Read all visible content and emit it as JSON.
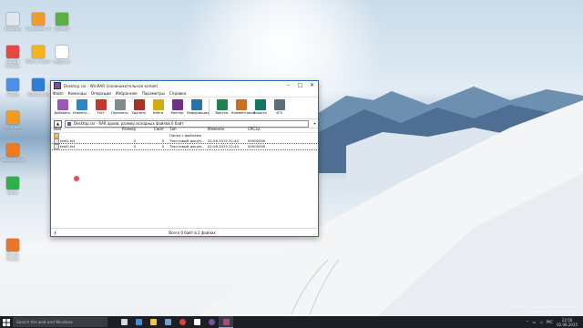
{
  "desktop": {
    "icons": [
      {
        "label": "Корзина",
        "color": "#dfe7ee"
      },
      {
        "label": "Безымянн. б",
        "color": "#f29a2e"
      },
      {
        "label": "uTorrent",
        "color": "#5fb043"
      },
      {
        "label": "Google Chrome",
        "color": "#e8473f"
      },
      {
        "label": "Mail.ru Агент",
        "color": "#f5b321"
      },
      {
        "label": "vegas.rar",
        "color": "#ffffff"
      },
      {
        "label": "Google",
        "color": "#4d8ee6"
      },
      {
        "label": "Проводник",
        "color": "#2e7dd6"
      },
      {
        "label": "mon exe",
        "color": "#f59a1e"
      },
      {
        "label": "Hearthstone",
        "color": "#f07a1a"
      },
      {
        "label": "Punto",
        "color": "#2fb14a"
      },
      {
        "label": "Mozilla Firefox",
        "color": "#e8762a"
      }
    ],
    "watermark_line1": "Windows 10 Enterprise Technical Preview",
    "watermark_line2": "Evaluation copy. Build 10240"
  },
  "window": {
    "title": "Desktop.rar - WinRAR (ознакомительная копия)",
    "controls": [
      "–",
      "□",
      "✕"
    ],
    "menu": [
      "Файл",
      "Команды",
      "Операции",
      "Избранное",
      "Параметры",
      "Справка"
    ],
    "toolbar": [
      {
        "label": "Добавить",
        "icon": "add-icon",
        "color": "#9b59b6"
      },
      {
        "label": "Извлечь...",
        "icon": "extract-icon",
        "color": "#2e86c1"
      },
      {
        "label": "Тест",
        "icon": "test-icon",
        "color": "#c0392b"
      },
      {
        "label": "Просмотр",
        "icon": "view-icon",
        "color": "#7f8c8d"
      },
      {
        "label": "Удалить",
        "icon": "delete-icon",
        "color": "#a93226"
      },
      {
        "label": "Найти",
        "icon": "find-icon",
        "color": "#d4ac0d"
      },
      {
        "label": "Мастер",
        "icon": "wizard-icon",
        "color": "#6c3483"
      },
      {
        "label": "Информация",
        "icon": "info-icon",
        "color": "#2874a6"
      },
      {
        "label": "Вирусы",
        "icon": "virus-icon",
        "color": "#1e8449"
      },
      {
        "label": "Комментарий",
        "icon": "comment-icon",
        "color": "#ca6f1e"
      },
      {
        "label": "Защита",
        "icon": "protect-icon",
        "color": "#117864"
      },
      {
        "label": "SFX",
        "icon": "sfx-icon",
        "color": "#5d6d7e"
      }
    ],
    "path": "Desktop.rar - RAR архив, размер исходных файлов 0 байт",
    "columns": [
      "Имя",
      "Размер",
      "Сжат",
      "Тип",
      "Изменён",
      "CRC32"
    ],
    "rows": [
      {
        "name": "..",
        "size": "",
        "packed": "",
        "type": "Папка с файлами",
        "modified": "",
        "crc": ""
      },
      {
        "name": "test1.txt",
        "size": "0",
        "packed": "0",
        "type": "Текстовый докум...",
        "modified": "02.06.2015 22:44",
        "crc": "00000000"
      },
      {
        "name": "test2.txt",
        "size": "0",
        "packed": "0",
        "type": "Текстовый докум...",
        "modified": "02.06.2015 22:44",
        "crc": "00000000"
      }
    ],
    "status": "Всего 0 байт в 2 файлах"
  },
  "taskbar": {
    "search_placeholder": "Search the web and Windows",
    "apps": [
      {
        "name": "task-view",
        "color": "#cfd8e3"
      },
      {
        "name": "edge",
        "color": "#3b8ed8"
      },
      {
        "name": "explorer",
        "color": "#f2c14e"
      },
      {
        "name": "store",
        "color": "#6ea1d8"
      },
      {
        "name": "chrome",
        "color": "#e34133"
      },
      {
        "name": "media",
        "color": "#ffffff"
      },
      {
        "name": "viber",
        "color": "#7b519d"
      },
      {
        "name": "winrar",
        "color": "#b0477d"
      }
    ],
    "language": "РУС",
    "time": "22:50",
    "date": "02.06.2015"
  }
}
